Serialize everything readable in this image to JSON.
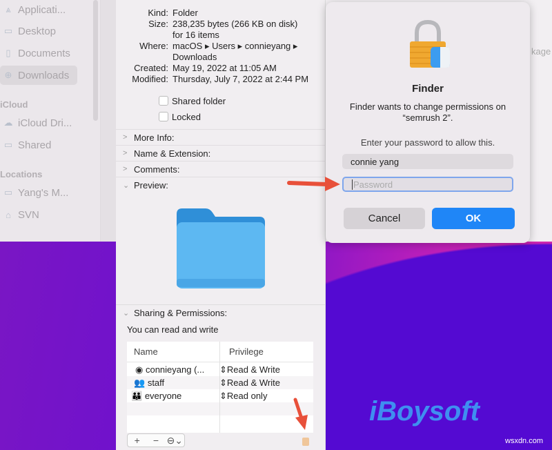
{
  "sidebar": {
    "items": [
      {
        "label": "Applicati...",
        "icon": "applications-icon"
      },
      {
        "label": "Desktop",
        "icon": "desktop-icon"
      },
      {
        "label": "Documents",
        "icon": "document-icon"
      },
      {
        "label": "Downloads",
        "icon": "downloads-icon",
        "selected": true
      }
    ],
    "icloud_header": "iCloud",
    "icloud_items": [
      {
        "label": "iCloud Dri...",
        "icon": "cloud-icon"
      },
      {
        "label": "Shared",
        "icon": "shared-folder-icon"
      }
    ],
    "locations_header": "Locations",
    "location_items": [
      {
        "label": "Yang's M...",
        "icon": "laptop-icon"
      },
      {
        "label": "SVN",
        "icon": "drive-icon"
      }
    ]
  },
  "info": {
    "kind_label": "Kind:",
    "kind": "Folder",
    "size_label": "Size:",
    "size": "238,235 bytes (266 KB on disk)",
    "size2": "for 16 items",
    "where_label": "Where:",
    "where": "macOS ▸ Users ▸ connieyang ▸",
    "where2": "Downloads",
    "created_label": "Created:",
    "created": "May 19, 2022 at 11:05 AM",
    "modified_label": "Modified:",
    "modified": "Thursday, July 7, 2022 at 2:44 PM",
    "shared_folder": "Shared folder",
    "locked": "Locked",
    "sections": [
      "More Info:",
      "Name & Extension:",
      "Comments:",
      "Preview:"
    ],
    "sharing_title": "Sharing & Permissions:",
    "sharing_status": "You can read and write",
    "table": {
      "headers": [
        "Name",
        "Privilege"
      ],
      "rows": [
        {
          "name": "connieyang (...",
          "privilege": "Read & Write",
          "icon": "user-icon"
        },
        {
          "name": "staff",
          "privilege": "Read & Write",
          "icon": "group-icon"
        },
        {
          "name": "everyone",
          "privilege": "Read only",
          "icon": "everyone-icon"
        }
      ]
    },
    "add": "+",
    "remove": "−",
    "action": "⊖⌄"
  },
  "background_text": "kage",
  "dialog": {
    "title": "Finder",
    "message": "Finder wants to change permissions on “semrush 2”.",
    "prompt": "Enter your password to allow this.",
    "username": "connie yang",
    "password_placeholder": "Password",
    "cancel": "Cancel",
    "ok": "OK",
    "accent": "#1f86f7"
  },
  "watermark": "iBoysoft",
  "watermark_site": "wsxdn.com"
}
